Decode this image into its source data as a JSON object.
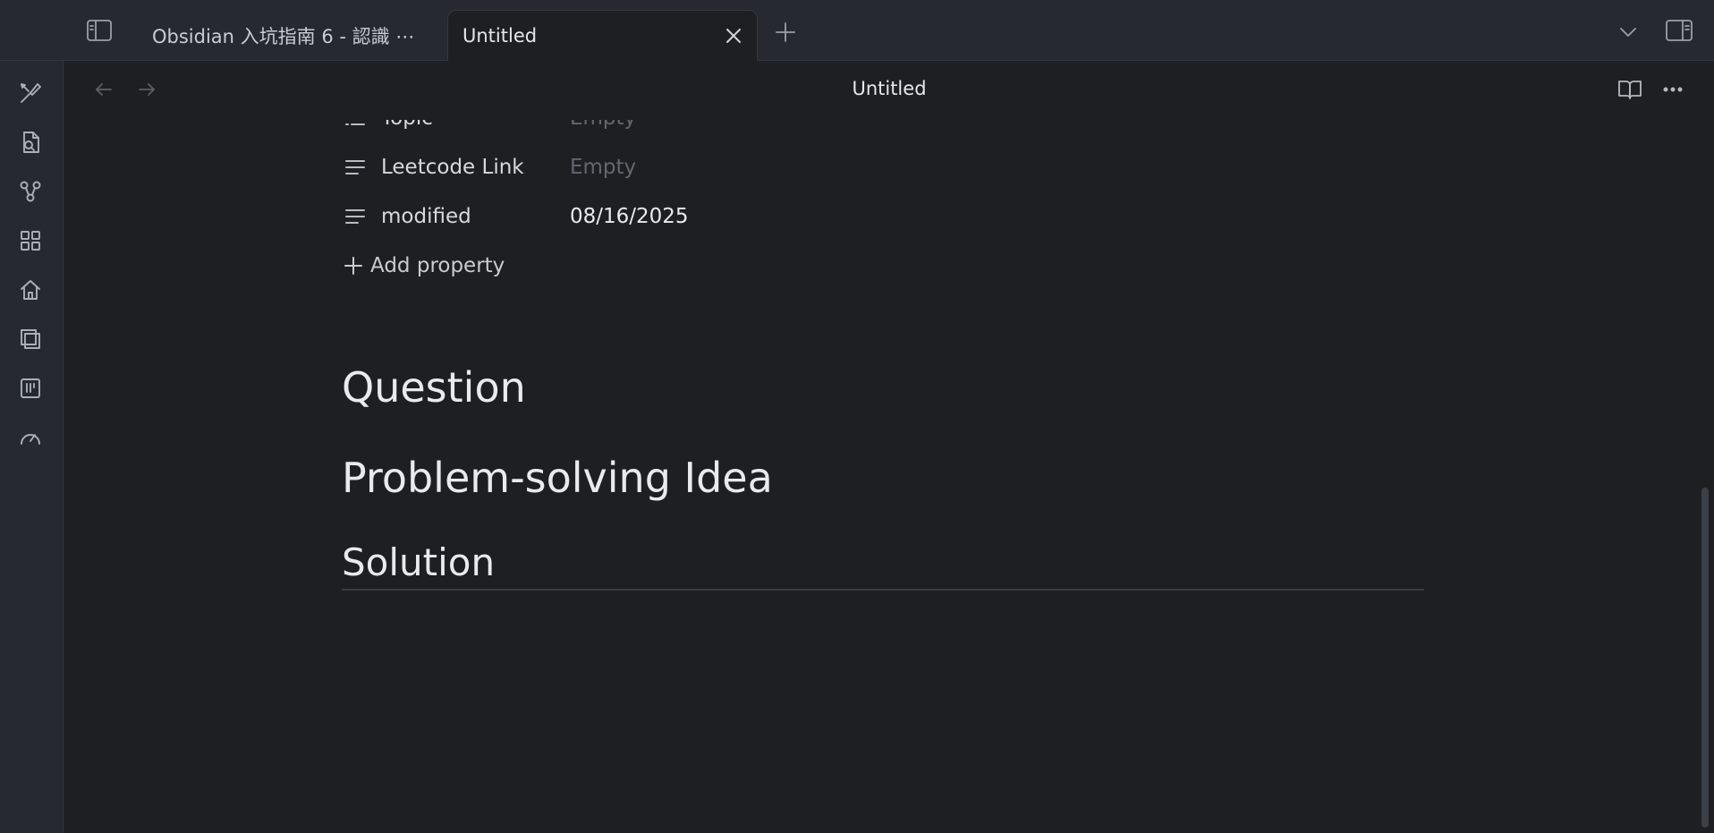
{
  "tabs": {
    "inactive_label": "Obsidian 入坑指南 6 - 認識 ⋯",
    "active_label": "Untitled"
  },
  "view": {
    "title": "Untitled"
  },
  "properties": [
    {
      "key": "Topic",
      "value": "Empty",
      "is_empty": true
    },
    {
      "key": "Leetcode Link",
      "value": "Empty",
      "is_empty": true
    },
    {
      "key": "modified",
      "value": "08/16/2025",
      "is_empty": false
    }
  ],
  "add_property_label": "Add property",
  "headings": [
    "Question",
    "Problem-solving Idea",
    "Solution"
  ],
  "icons": {
    "left_sidebar_toggle": "sidebar-left-icon",
    "new_tab": "plus-icon",
    "tab_list": "chevron-down-icon",
    "right_sidebar_toggle": "sidebar-right-icon",
    "close_tab": "close-icon",
    "back": "arrow-left-icon",
    "forward": "arrow-right-icon",
    "reading_view": "book-open-icon",
    "more_options": "more-horizontal-icon",
    "ribbon": [
      "brush-icon",
      "file-search-icon",
      "graph-icon",
      "layout-grid-icon",
      "home-icon",
      "layers-icon",
      "kanban-icon",
      "gauge-icon"
    ]
  },
  "colors": {
    "background": "#1e1f23",
    "chrome": "#262a30",
    "text": "#dcddde",
    "muted": "#62676f"
  }
}
